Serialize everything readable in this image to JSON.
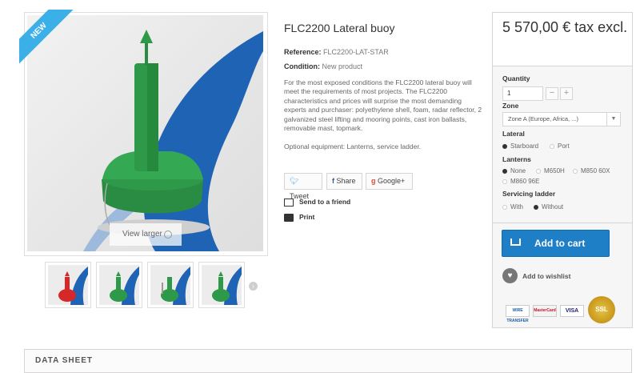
{
  "product": {
    "badge": "NEW",
    "view_larger": "View larger",
    "title": "FLC2200 Lateral buoy",
    "reference_label": "Reference:",
    "reference_value": "FLC2200-LAT-STAR",
    "condition_label": "Condition:",
    "condition_value": "New product",
    "description": "For the most exposed conditions the FLC2200 lateral buoy will meet the requirements of most projects. The FLC2200 characteristics and prices will surprise the most demanding experts and purchaser: polyethylene shell, foam, radar reflector, 2 galvanized steel lifting and mooring points, cast iron ballasts, removable mast, topmark.",
    "optional": "Optional equipment: Lanterns, service ladder."
  },
  "share": {
    "tweet": "Tweet",
    "share": "Share",
    "google": "Google+"
  },
  "links": {
    "send_friend": "Send to a friend",
    "print": "Print"
  },
  "buy": {
    "price": "5 570,00 € tax excl.",
    "quantity_label": "Quantity",
    "quantity_value": "1",
    "zone_label": "Zone",
    "zone_value": "Zone A (Europe, Africa, ...)",
    "lateral_label": "Lateral",
    "lateral_options": [
      "Starboard",
      "Port"
    ],
    "lanterns_label": "Lanterns",
    "lantern_options": [
      "None",
      "M650H",
      "M850 60X",
      "M860 96E"
    ],
    "ladder_label": "Servicing ladder",
    "ladder_options": [
      "With",
      "Without"
    ],
    "add_to_cart": "Add to cart",
    "wishlist": "Add to wishlist",
    "payments": [
      "WIRE TRANSFER",
      "MasterCard",
      "VISA",
      "SSL"
    ]
  },
  "datasheet": {
    "title": "DATA SHEET"
  },
  "colors": {
    "accent": "#1e7fc7",
    "badge": "#3bb0e8",
    "buoy": "#2e9a49"
  }
}
